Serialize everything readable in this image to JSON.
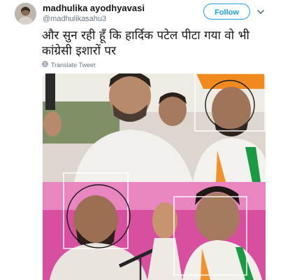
{
  "tweet": {
    "display_name": "madhulika ayodhyavasi",
    "handle": "@madhulikasahu3",
    "follow_label": "Follow",
    "text_line1": "और सुन रही हूँ कि हार्दिक पटेल पीटा गया वो भी",
    "text_line2": "कांग्रेसी इशारों पर",
    "translate_label": "Translate Tweet"
  },
  "icons": {
    "avatar": "user-avatar",
    "more": "chevron-down-icon",
    "translate": "globe-icon"
  },
  "colors": {
    "accent": "#1da1f2",
    "text": "#14171a",
    "secondary": "#657786"
  }
}
